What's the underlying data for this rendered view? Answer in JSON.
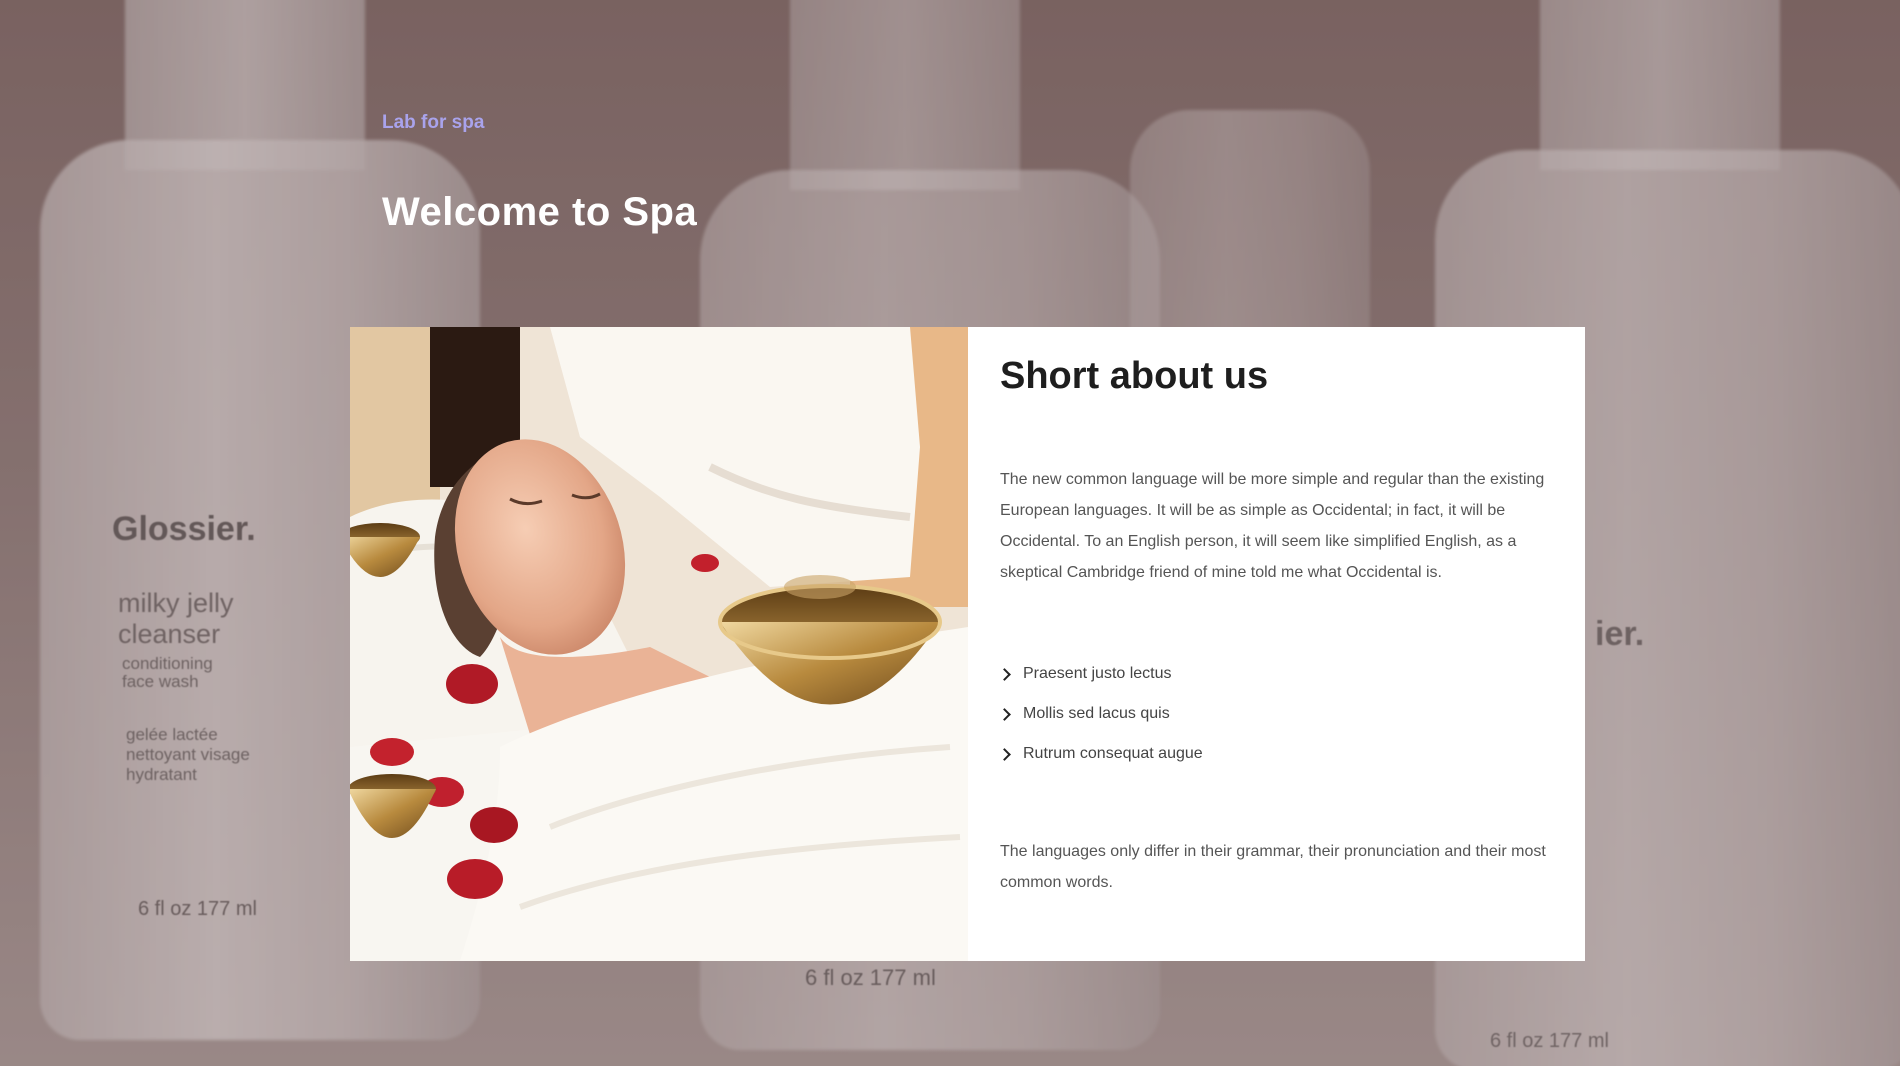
{
  "hero": {
    "eyebrow": "Lab for spa",
    "title": "Welcome to Spa",
    "accent_color": "#a9a3ec"
  },
  "background_products": {
    "brand": "Glossier.",
    "product_name_line1": "milky jelly",
    "product_name_line2": "cleanser",
    "subtitle_line1": "conditioning",
    "subtitle_line2": "face wash",
    "french_line1": "gelée lactée",
    "french_line2": "nettoyant visage",
    "french_line3": "hydratant",
    "volume": "6 fl oz   177 ml",
    "brand_fragment": "ier."
  },
  "about": {
    "title": "Short about us",
    "paragraph1": "The new common language will be more simple and regular than the existing European languages. It will be as simple as Occidental; in fact, it will be Occidental. To an English person, it will seem like simplified English, as a skeptical Cambridge friend of mine told me what Occidental is.",
    "features": [
      "Praesent justo lectus",
      "Mollis sed lacus quis",
      "Rutrum consequat augue"
    ],
    "paragraph2": "The languages only differ in their grammar, their pronunciation and their most common words.",
    "photo_icon": "spa-massage-photo"
  }
}
